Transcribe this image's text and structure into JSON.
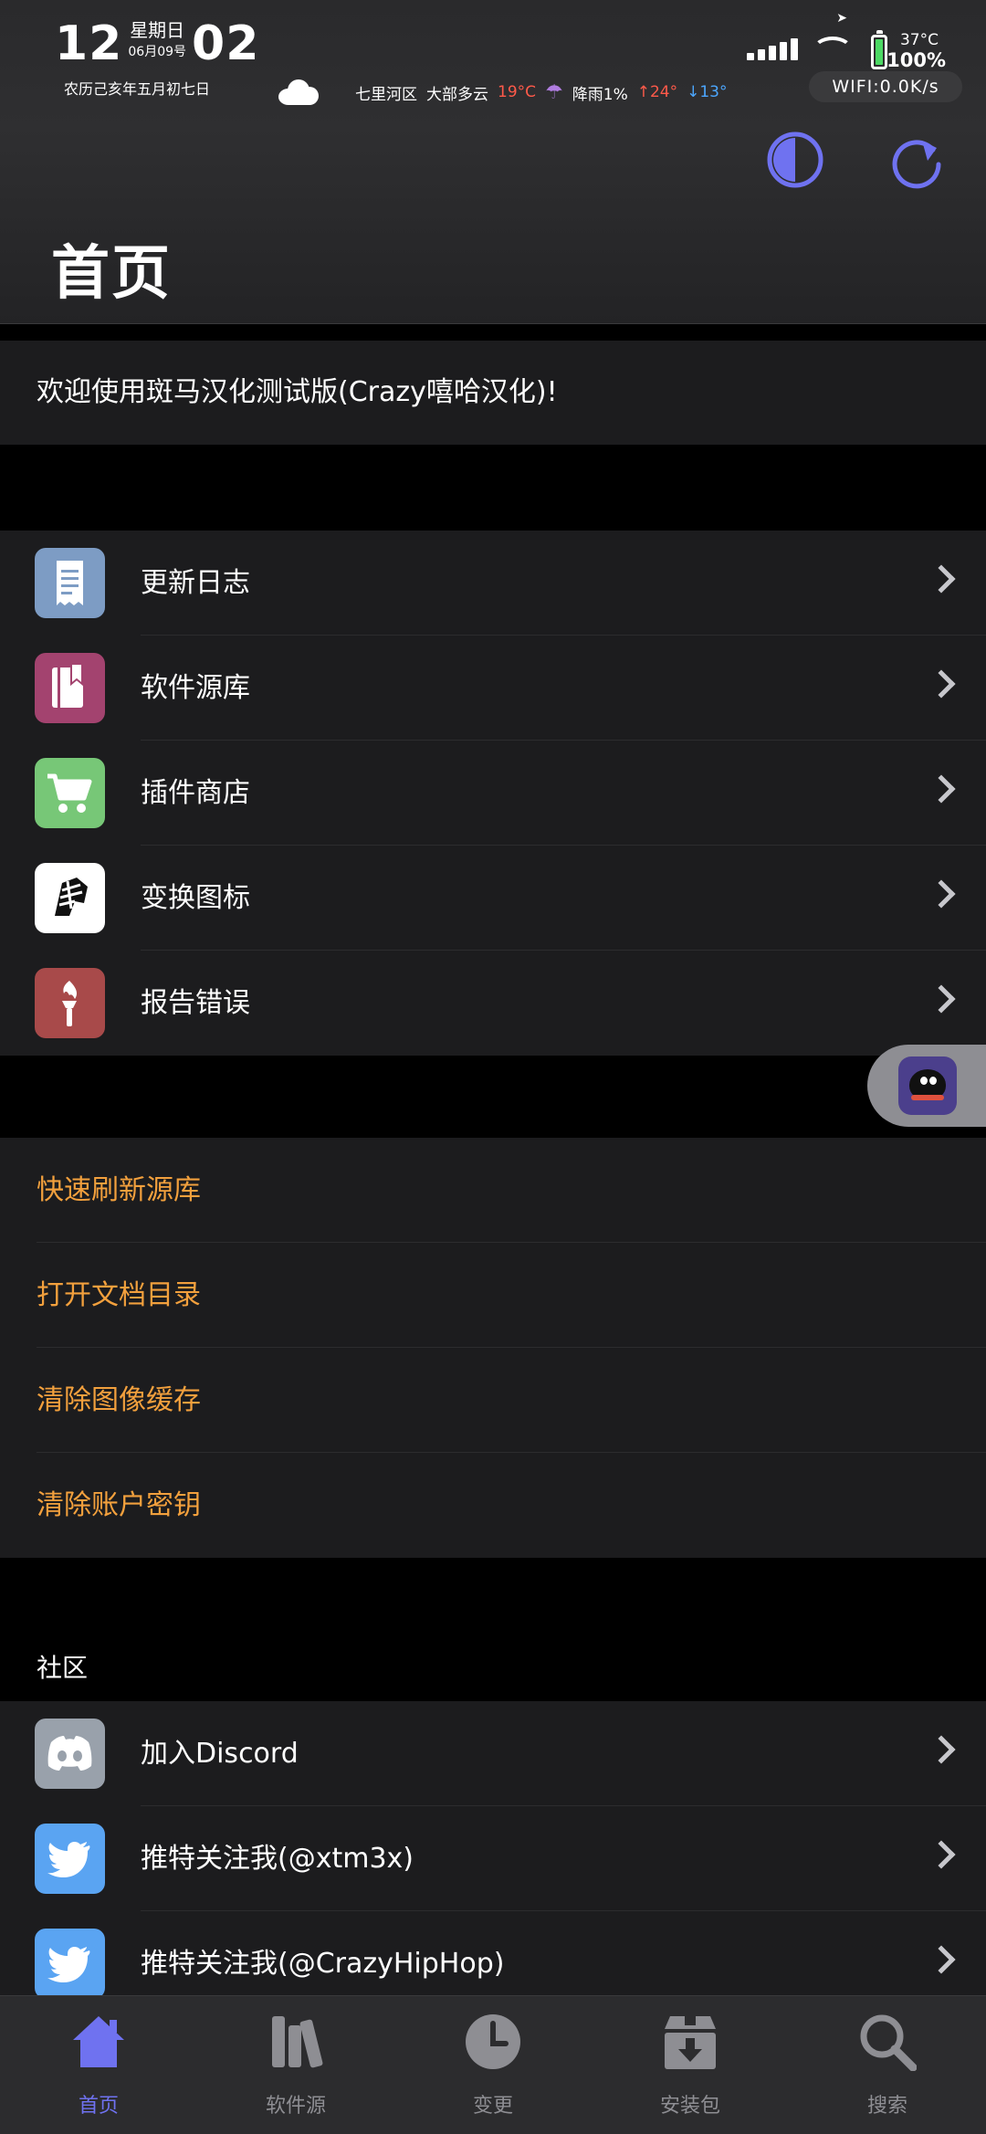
{
  "status_bar": {
    "hour": "12",
    "weekday": "星期日",
    "date": "06月09号",
    "minute": "02",
    "lunar": "农历己亥年五月初七日",
    "location": "七里河区",
    "condition": "大部多云",
    "temperature": "19°C",
    "rain": "降雨1%",
    "high": "↑24°",
    "low": "↓13°",
    "battery_temp": "37°C",
    "battery_pct": "100%",
    "network_speed": "WIFI:0.0K/s"
  },
  "header": {
    "title": "首页"
  },
  "welcome": {
    "text": "欢迎使用斑马汉化测试版(Crazy嘻哈汉化)!"
  },
  "menu": [
    {
      "label": "更新日志",
      "icon": "receipt-icon",
      "color": "#7d9cc4"
    },
    {
      "label": "软件源库",
      "icon": "book-icon",
      "color": "#a3436f"
    },
    {
      "label": "插件商店",
      "icon": "cart-icon",
      "color": "#77c777"
    },
    {
      "label": "变换图标",
      "icon": "zebra-icon",
      "color": "#ffffff"
    },
    {
      "label": "报告错误",
      "icon": "torch-icon",
      "color": "#a84a4a"
    }
  ],
  "actions": [
    {
      "label": "快速刷新源库"
    },
    {
      "label": "打开文档目录"
    },
    {
      "label": "清除图像缓存"
    },
    {
      "label": "清除账户密钥"
    }
  ],
  "community": {
    "label": "社区",
    "items": [
      {
        "label": "加入Discord",
        "icon": "discord-icon",
        "color": "#99a1ab"
      },
      {
        "label": "推特关注我(@xtm3x)",
        "icon": "twitter-icon",
        "color": "#5aa4f2"
      },
      {
        "label": "推特关注我(@CrazyHipHop)",
        "icon": "twitter-icon",
        "color": "#5aa4f2"
      }
    ]
  },
  "tabs": [
    {
      "label": "首页",
      "icon": "home-icon",
      "active": true
    },
    {
      "label": "软件源",
      "icon": "sources-icon",
      "active": false
    },
    {
      "label": "变更",
      "icon": "clock-icon",
      "active": false
    },
    {
      "label": "安装包",
      "icon": "package-icon",
      "active": false
    },
    {
      "label": "搜索",
      "icon": "search-icon",
      "active": false
    }
  ],
  "colors": {
    "accent": "#6f72f0",
    "action_text": "#f2a03d",
    "cell_bg": "#1c1c1e"
  }
}
